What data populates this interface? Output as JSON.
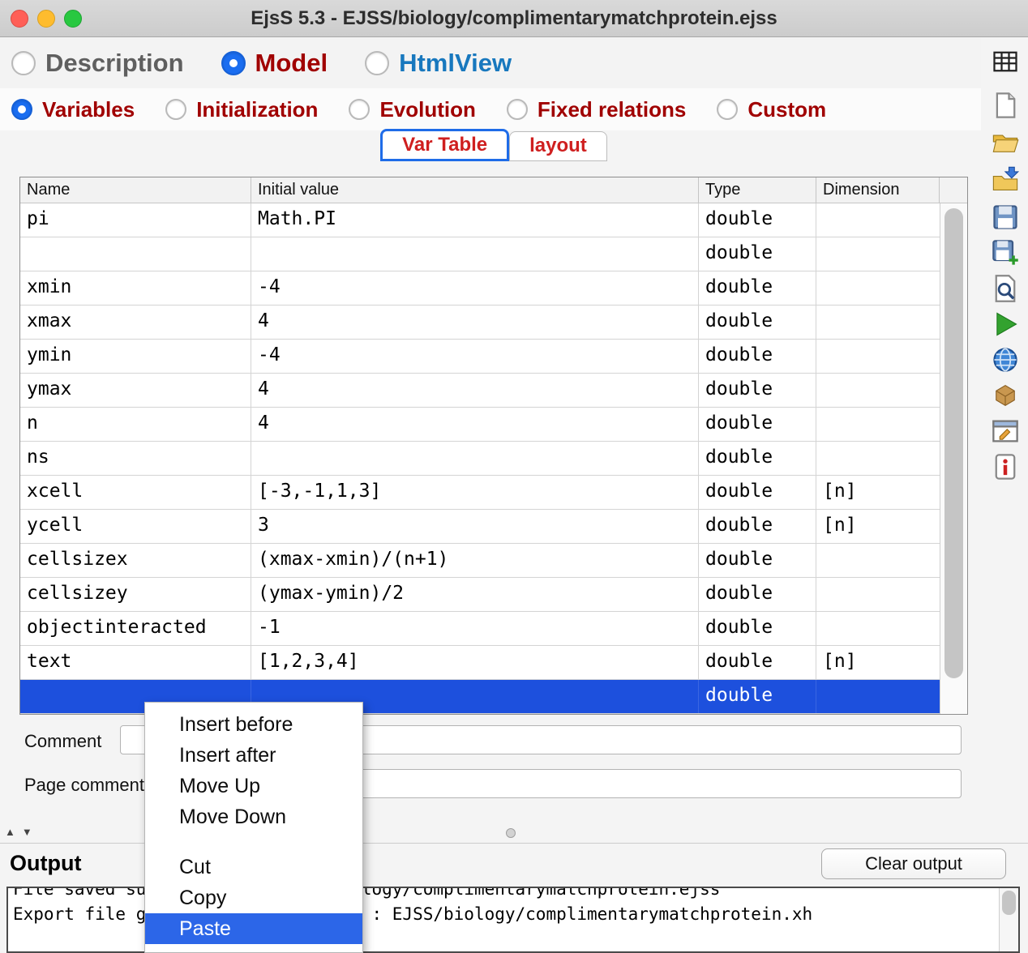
{
  "window": {
    "title": "EjsS 5.3 - EJSS/biology/complimentarymatchprotein.ejss"
  },
  "colors": {
    "selection_blue": "#1d50dd",
    "menu_highlight": "#2c66e8",
    "model_red": "#a00000",
    "htmlview_blue": "#1878be",
    "tab_red": "#cf1f1f",
    "radio_blue": "#1a6df0"
  },
  "main_tabs": {
    "items": [
      {
        "label": "Description",
        "selected": false,
        "color": "#5f5f5f"
      },
      {
        "label": "Model",
        "selected": true,
        "color": "#a00000"
      },
      {
        "label": "HtmlView",
        "selected": false,
        "color": "#1878be"
      }
    ]
  },
  "model_tabs": {
    "items": [
      {
        "label": "Variables",
        "selected": true,
        "color": "#a00000"
      },
      {
        "label": "Initialization",
        "selected": false,
        "color": "#a00000"
      },
      {
        "label": "Evolution",
        "selected": false,
        "color": "#a00000"
      },
      {
        "label": "Fixed relations",
        "selected": false,
        "color": "#a00000"
      },
      {
        "label": "Custom",
        "selected": false,
        "color": "#a00000"
      }
    ]
  },
  "page_tabs": {
    "items": [
      {
        "label": "Var Table",
        "selected": true
      },
      {
        "label": "layout",
        "selected": false
      }
    ]
  },
  "var_table": {
    "columns": [
      "Name",
      "Initial value",
      "Type",
      "Dimension"
    ],
    "rows": [
      {
        "name": "pi",
        "value": "Math.PI",
        "type": "double",
        "dimension": "",
        "selected": false
      },
      {
        "name": "",
        "value": "",
        "type": "double",
        "dimension": "",
        "selected": false
      },
      {
        "name": "xmin",
        "value": "-4",
        "type": "double",
        "dimension": "",
        "selected": false
      },
      {
        "name": "xmax",
        "value": "4",
        "type": "double",
        "dimension": "",
        "selected": false
      },
      {
        "name": "ymin",
        "value": "-4",
        "type": "double",
        "dimension": "",
        "selected": false
      },
      {
        "name": "ymax",
        "value": "4",
        "type": "double",
        "dimension": "",
        "selected": false
      },
      {
        "name": "n",
        "value": "4",
        "type": "double",
        "dimension": "",
        "selected": false
      },
      {
        "name": "ns",
        "value": "",
        "type": "double",
        "dimension": "",
        "selected": false
      },
      {
        "name": "xcell",
        "value": "[-3,-1,1,3]",
        "type": "double",
        "dimension": "[n]",
        "selected": false
      },
      {
        "name": "ycell",
        "value": "3",
        "type": "double",
        "dimension": "[n]",
        "selected": false
      },
      {
        "name": "cellsizex",
        "value": "(xmax-xmin)/(n+1)",
        "type": "double",
        "dimension": "",
        "selected": false
      },
      {
        "name": "cellsizey",
        "value": "(ymax-ymin)/2",
        "type": "double",
        "dimension": "",
        "selected": false
      },
      {
        "name": "objectinteracted",
        "value": "-1",
        "type": "double",
        "dimension": "",
        "selected": false
      },
      {
        "name": "text",
        "value": "[1,2,3,4]",
        "type": "double",
        "dimension": "[n]",
        "selected": false
      },
      {
        "name": "",
        "value": "",
        "type": "double",
        "dimension": "",
        "selected": true
      }
    ]
  },
  "comments": {
    "comment_label": "Comment",
    "comment_value": "",
    "page_comment_label": "Page comment",
    "page_comment_value": ""
  },
  "context_menu": {
    "items": [
      {
        "label": "Insert before"
      },
      {
        "label": "Insert after"
      },
      {
        "label": "Move Up"
      },
      {
        "label": "Move Down"
      },
      {
        "separator": true
      },
      {
        "label": "Cut"
      },
      {
        "label": "Copy"
      },
      {
        "label": "Paste",
        "highlighted": true
      }
    ]
  },
  "output": {
    "title": "Output",
    "clear_button": "Clear output",
    "lines": [
      "File saved successfully : EJSS/biology/complimentarymatchprotein.ejss",
      "Export file generated successfully : EJSS/biology/complimentarymatchprotein.xh"
    ]
  },
  "toolbar": {
    "icons": [
      "table-icon",
      "new-file-icon",
      "open-folder-icon",
      "import-folder-icon",
      "save-icon",
      "save-as-icon",
      "preview-icon",
      "run-icon",
      "globe-icon",
      "package-icon",
      "options-icon",
      "info-icon"
    ]
  }
}
